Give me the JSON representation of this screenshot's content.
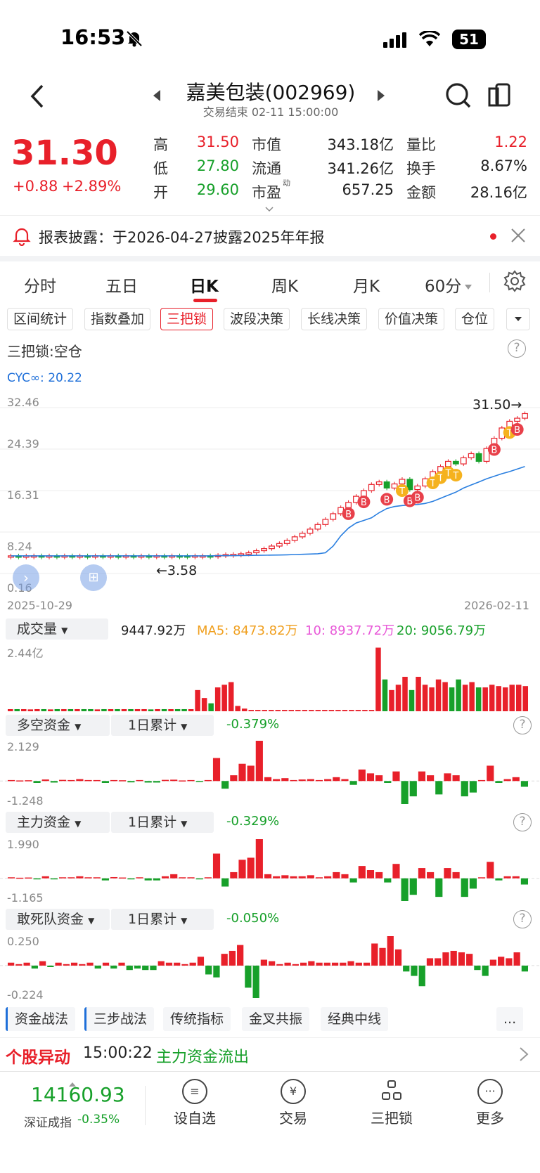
{
  "status_bar": {
    "time": "16:53",
    "battery": "51"
  },
  "header": {
    "title": "嘉美包装(002969)",
    "subtitle": "交易结束 02-11 15:00:00"
  },
  "quote": {
    "price": "31.30",
    "change": "+0.88",
    "change_pct": "+2.89%",
    "high_label": "高",
    "high": "31.50",
    "low_label": "低",
    "low": "27.80",
    "open_label": "开",
    "open": "29.60",
    "mktcap_label": "市值",
    "mktcap": "343.18亿",
    "float_label": "流通",
    "float": "341.26亿",
    "pe_label": "市盈",
    "pe_sup": "动",
    "pe": "657.25",
    "volratio_label": "量比",
    "volratio": "1.22",
    "turnover_label": "换手",
    "turnover": "8.67%",
    "amount_label": "金额",
    "amount": "28.16亿"
  },
  "notice": {
    "text": "报表披露：于2026-04-27披露2025年年报"
  },
  "tabs": [
    "分时",
    "五日",
    "日K",
    "周K",
    "月K",
    "60分"
  ],
  "active_tab": "日K",
  "tools": [
    "区间统计",
    "指数叠加",
    "三把锁",
    "波段决策",
    "长线决策",
    "价值决策",
    "仓位"
  ],
  "active_tool": "三把锁",
  "lock_status": {
    "label": "三把锁:空仓"
  },
  "cyc": "CYC∞: 20.22",
  "kline": {
    "y_ticks": [
      "32.46",
      "24.39",
      "16.31",
      "8.24",
      "0.16"
    ],
    "date_start": "2025-10-29",
    "date_end": "2026-02-11",
    "annot_low": "←3.58",
    "annot_high": "31.50→"
  },
  "volume": {
    "selector": "成交量",
    "value": "9447.92万",
    "ma5": "MA5: 8473.82万",
    "ma10": "10: 8937.72万",
    "ma20": "20: 9056.79万",
    "max_label": "2.44亿"
  },
  "fund_panels": [
    {
      "selector": "多空资金",
      "period": "1日累计",
      "value": "-0.379%",
      "top": "2.129",
      "bottom": "-1.248"
    },
    {
      "selector": "主力资金",
      "period": "1日累计",
      "value": "-0.329%",
      "top": "1.990",
      "bottom": "-1.165"
    },
    {
      "selector": "敢死队资金",
      "period": "1日累计",
      "value": "-0.050%",
      "top": "0.250",
      "bottom": "-0.224"
    }
  ],
  "indicators": [
    "资金战法",
    "三步战法",
    "传统指标",
    "金叉共振",
    "经典中线",
    "..."
  ],
  "alert": {
    "label": "个股异动",
    "time": "15:00:22",
    "text": "主力资金流出"
  },
  "bottom_nav": {
    "index_value": "14160.93",
    "index_name": "深证成指",
    "index_change": "-0.35%",
    "items": [
      "设自选",
      "交易",
      "三把锁",
      "更多"
    ]
  },
  "chart_data": {
    "type": "candlestick",
    "title": "",
    "x_range": [
      "2025-10-29",
      "2026-02-11"
    ],
    "ylim": [
      0.16,
      32.46
    ],
    "closes": [
      3.6,
      3.58,
      3.6,
      3.62,
      3.6,
      3.61,
      3.6,
      3.62,
      3.6,
      3.61,
      3.6,
      3.62,
      3.6,
      3.61,
      3.6,
      3.62,
      3.6,
      3.61,
      3.6,
      3.62,
      3.6,
      3.62,
      3.61,
      3.6,
      3.62,
      3.62,
      3.58,
      3.7,
      3.85,
      3.9,
      4.0,
      4.2,
      4.6,
      5.0,
      5.5,
      6.0,
      6.6,
      7.3,
      8.0,
      8.8,
      9.7,
      10.7,
      11.8,
      13.0,
      14.0,
      15.2,
      16.3,
      17.5,
      18.0,
      16.8,
      17.6,
      18.5,
      16.5,
      17.2,
      18.6,
      20.0,
      21.0,
      22.0,
      21.5,
      22.7,
      23.5,
      22.0,
      24.5,
      26.5,
      28.5,
      29.8,
      30.4,
      31.3
    ],
    "ma_line": [
      3.6,
      3.6,
      3.6,
      3.6,
      3.6,
      3.6,
      3.6,
      3.6,
      3.6,
      3.6,
      3.6,
      3.6,
      3.6,
      3.6,
      3.6,
      3.6,
      3.6,
      3.6,
      3.6,
      3.6,
      3.6,
      3.6,
      3.6,
      3.6,
      3.6,
      3.6,
      3.6,
      3.62,
      3.63,
      3.64,
      3.66,
      3.68,
      3.7,
      3.72,
      3.74,
      3.76,
      3.8,
      3.85,
      3.9,
      3.95,
      4.0,
      4.2,
      5.5,
      7.5,
      9.0,
      10.0,
      10.5,
      11.0,
      12.0,
      12.8,
      13.2,
      13.4,
      13.5,
      13.6,
      13.8,
      14.2,
      14.8,
      15.4,
      16.0,
      16.8,
      17.4,
      18.0,
      18.6,
      19.1,
      19.6,
      20.0,
      20.5,
      21.0
    ]
  },
  "volume_data": {
    "ylim": [
      0,
      2.44
    ],
    "values": [
      0.08,
      0.08,
      0.08,
      0.07,
      0.08,
      0.08,
      0.07,
      0.08,
      0.08,
      0.08,
      0.08,
      0.08,
      0.08,
      0.07,
      0.08,
      0.08,
      0.08,
      0.08,
      0.08,
      0.08,
      0.08,
      0.07,
      0.08,
      0.08,
      0.08,
      0.08,
      0.08,
      0.08,
      0.8,
      0.5,
      0.3,
      0.9,
      1.0,
      1.1,
      0.2,
      0.1,
      0.05,
      0.05,
      0.05,
      0.05,
      0.05,
      0.05,
      0.05,
      0.05,
      0.05,
      0.05,
      0.05,
      0.05,
      0.05,
      0.05,
      0.05,
      0.05,
      0.05,
      0.05,
      0.05,
      2.4,
      1.2,
      0.8,
      1.0,
      1.3,
      0.8,
      1.3,
      1.0,
      0.9,
      1.2,
      1.1,
      0.9,
      1.2,
      1.0,
      1.1,
      0.9,
      0.9,
      1.0,
      0.95,
      0.9,
      1.0,
      1.0,
      0.95
    ]
  },
  "fund_data": [
    {
      "values": [
        0.05,
        0.03,
        0.04,
        -0.1,
        0.08,
        -0.08,
        0.06,
        0.05,
        0.1,
        0.05,
        0.05,
        -0.1,
        0.05,
        0.04,
        -0.07,
        0.05,
        -0.08,
        -0.08,
        0.06,
        0.07,
        0.03,
        0.05,
        -0.05,
        0.05,
        1.2,
        -0.4,
        0.3,
        0.9,
        0.8,
        2.1,
        0.2,
        0.1,
        0.15,
        0.05,
        0.08,
        0.1,
        0.05,
        0.1,
        0.2,
        0.1,
        -0.2,
        0.6,
        0.4,
        0.3,
        -0.1,
        0.5,
        -1.2,
        -0.8,
        0.5,
        0.3,
        -0.7,
        0.4,
        0.3,
        -0.8,
        -0.6,
        0.05,
        0.8,
        -0.1,
        0.1,
        0.2,
        -0.3
      ]
    },
    {
      "values": [
        0.05,
        0.03,
        0.04,
        -0.05,
        0.1,
        -0.05,
        0.05,
        0.05,
        0.1,
        0.05,
        0.05,
        -0.1,
        0.06,
        0.04,
        -0.05,
        0.05,
        -0.1,
        -0.1,
        0.1,
        0.2,
        0.05,
        0.05,
        -0.05,
        0.05,
        1.2,
        -0.4,
        0.3,
        0.9,
        1.0,
        1.9,
        0.2,
        0.1,
        0.15,
        0.1,
        0.1,
        0.15,
        0.05,
        0.1,
        0.3,
        0.2,
        -0.2,
        0.6,
        0.4,
        0.3,
        -0.2,
        0.7,
        -1.1,
        -0.8,
        0.5,
        0.3,
        -0.9,
        0.5,
        0.3,
        -0.9,
        -0.5,
        0.05,
        0.8,
        -0.1,
        0.1,
        0.1,
        -0.3
      ]
    },
    {
      "values": [
        0.02,
        0.01,
        0.02,
        -0.02,
        0.03,
        -0.01,
        0.02,
        0.01,
        0.02,
        0.01,
        0.02,
        -0.02,
        0.02,
        -0.02,
        0.02,
        -0.03,
        -0.02,
        -0.03,
        -0.03,
        0.03,
        0.02,
        0.02,
        0.01,
        0.02,
        0.06,
        -0.06,
        -0.08,
        0.08,
        0.1,
        0.14,
        -0.15,
        -0.22,
        0.04,
        0.03,
        0.01,
        0.02,
        0.01,
        0.02,
        0.03,
        0.02,
        0.02,
        0.02,
        0.02,
        0.03,
        0.02,
        0.02,
        0.15,
        0.12,
        0.2,
        0.11,
        -0.04,
        -0.07,
        -0.14,
        0.05,
        0.05,
        0.09,
        0.1,
        0.09,
        0.08,
        -0.03,
        -0.07,
        0.04,
        0.06,
        0.05,
        0.09,
        -0.04
      ]
    }
  ]
}
